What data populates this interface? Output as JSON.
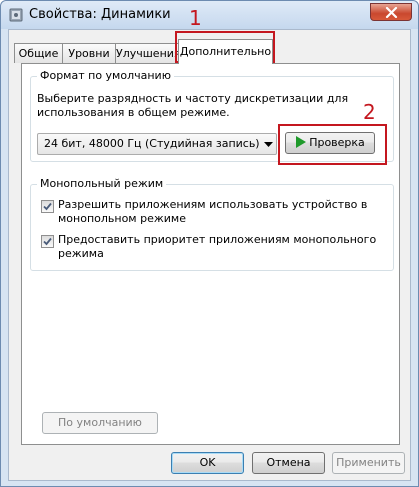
{
  "window": {
    "title": "Свойства: Динамики"
  },
  "tabs": [
    {
      "label": "Общие"
    },
    {
      "label": "Уровни"
    },
    {
      "label": "Улучшения"
    },
    {
      "label": "Дополнительно"
    }
  ],
  "default_format": {
    "title": "Формат по умолчанию",
    "description_line1": "Выберите разрядность и частоту дискретизации для",
    "description_line2": "использования в общем режиме.",
    "selected_format": "24 бит, 48000 Гц (Студийная запись)",
    "test_button": "Проверка"
  },
  "exclusive_mode": {
    "title": "Монопольный режим",
    "option1_line1": "Разрешить приложениям использовать устройство в",
    "option1_line2": "монопольном режиме",
    "option1_checked": true,
    "option2_line1": "Предоставить приоритет приложениям монопольного",
    "option2_line2": "режима",
    "option2_checked": true
  },
  "restore_defaults_button": "По умолчанию",
  "footer": {
    "ok": "OK",
    "cancel": "Отмена",
    "apply": "Применить"
  },
  "annotations": {
    "number1": "1",
    "number2": "2"
  },
  "colors": {
    "annotation": "#c4171f",
    "play_icon": "#1f9a2b",
    "check": "#4a5c7a"
  },
  "icons": {
    "title": "speaker-icon",
    "close": "close-icon",
    "combo": "chevron-down-icon",
    "test": "play-icon"
  }
}
